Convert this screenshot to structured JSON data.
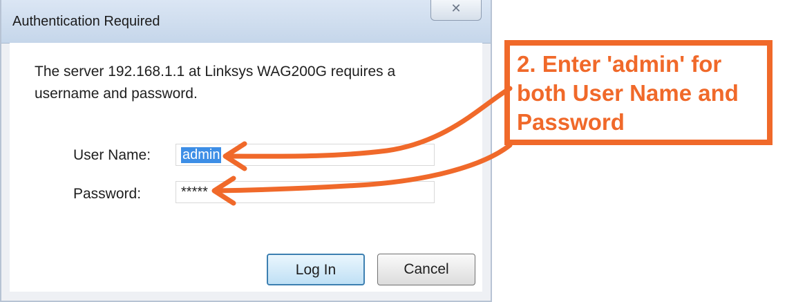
{
  "dialog": {
    "title": "Authentication Required",
    "close_glyph": "✕",
    "message": "The server 192.168.1.1 at Linksys WAG200G  requires a username and password.",
    "username_label": "User Name:",
    "username_value": "admin",
    "password_label": "Password:",
    "password_value": "*****",
    "login_label": "Log In",
    "cancel_label": "Cancel"
  },
  "annotation": {
    "text": "2. Enter 'admin' for both User Name and Password",
    "color": "#f0692a"
  }
}
